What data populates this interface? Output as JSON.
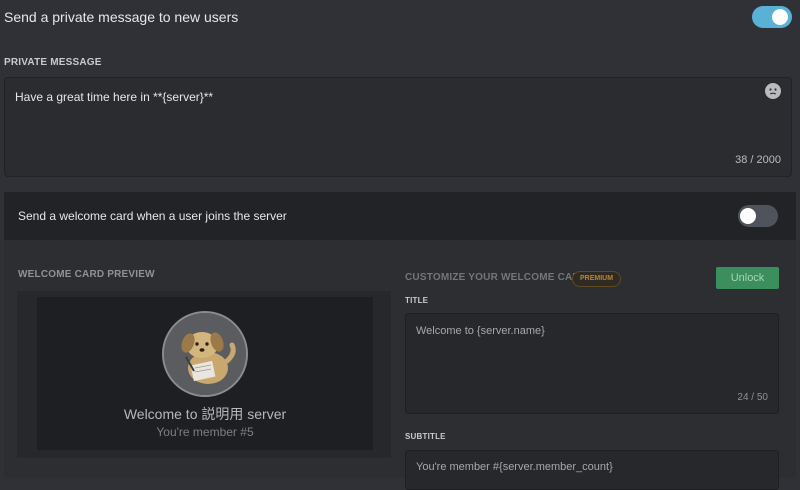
{
  "private_message_toggle": {
    "label": "Send a private message to new users",
    "enabled": true
  },
  "private_message": {
    "section_title": "PRIVATE MESSAGE",
    "text": "Have a great time here in **{server}**",
    "counter": "38 / 2000",
    "emoji_icon": "emoji-icon"
  },
  "welcome_card_toggle": {
    "label": "Send a welcome card when a user joins the server",
    "enabled": false
  },
  "preview": {
    "section_title": "WELCOME CARD PREVIEW",
    "welcome_text": "Welcome to 説明用 server",
    "member_text": "You're member #5"
  },
  "customize": {
    "section_title": "CUSTOMIZE YOUR WELCOME CARD",
    "premium_badge": "PREMIUM",
    "unlock_label": "Unlock",
    "title_label": "TITLE",
    "title_value": "Welcome to {server.name}",
    "title_counter": "24 / 50",
    "subtitle_label": "SUBTITLE",
    "subtitle_value": "You're member #{server.member_count}"
  },
  "colors": {
    "accent_toggle_on": "#5ab1d6",
    "unlock_green": "#3c8e5d",
    "premium_gold": "#b6872e"
  }
}
